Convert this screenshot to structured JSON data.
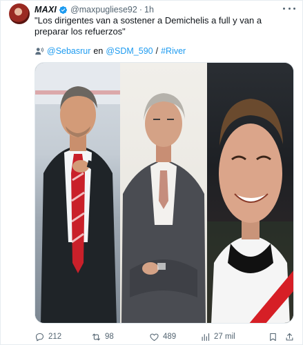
{
  "tweet": {
    "author_name": "MAXI",
    "handle": "@maxpugliese92",
    "separator": "·",
    "time": "1h",
    "text": "\"Los dirigentes van a sostener a Demichelis a full y van a preparar los refuerzos\"",
    "credit": {
      "source_handle": "@Sebasrur",
      "connector": "en",
      "station": "@SDM_590",
      "slash": "/",
      "hashtag": "#River"
    }
  },
  "actions": {
    "replies": "212",
    "retweets": "98",
    "likes": "489",
    "views": "27 mil"
  },
  "colors": {
    "link": "#1d9bf0",
    "secondary_text": "#536471",
    "river_red": "#d61f26"
  },
  "icons": [
    "verified-badge-icon",
    "more-icon",
    "speaker-icon",
    "reply-icon",
    "retweet-icon",
    "like-icon",
    "views-icon",
    "bookmark-icon",
    "share-icon"
  ]
}
